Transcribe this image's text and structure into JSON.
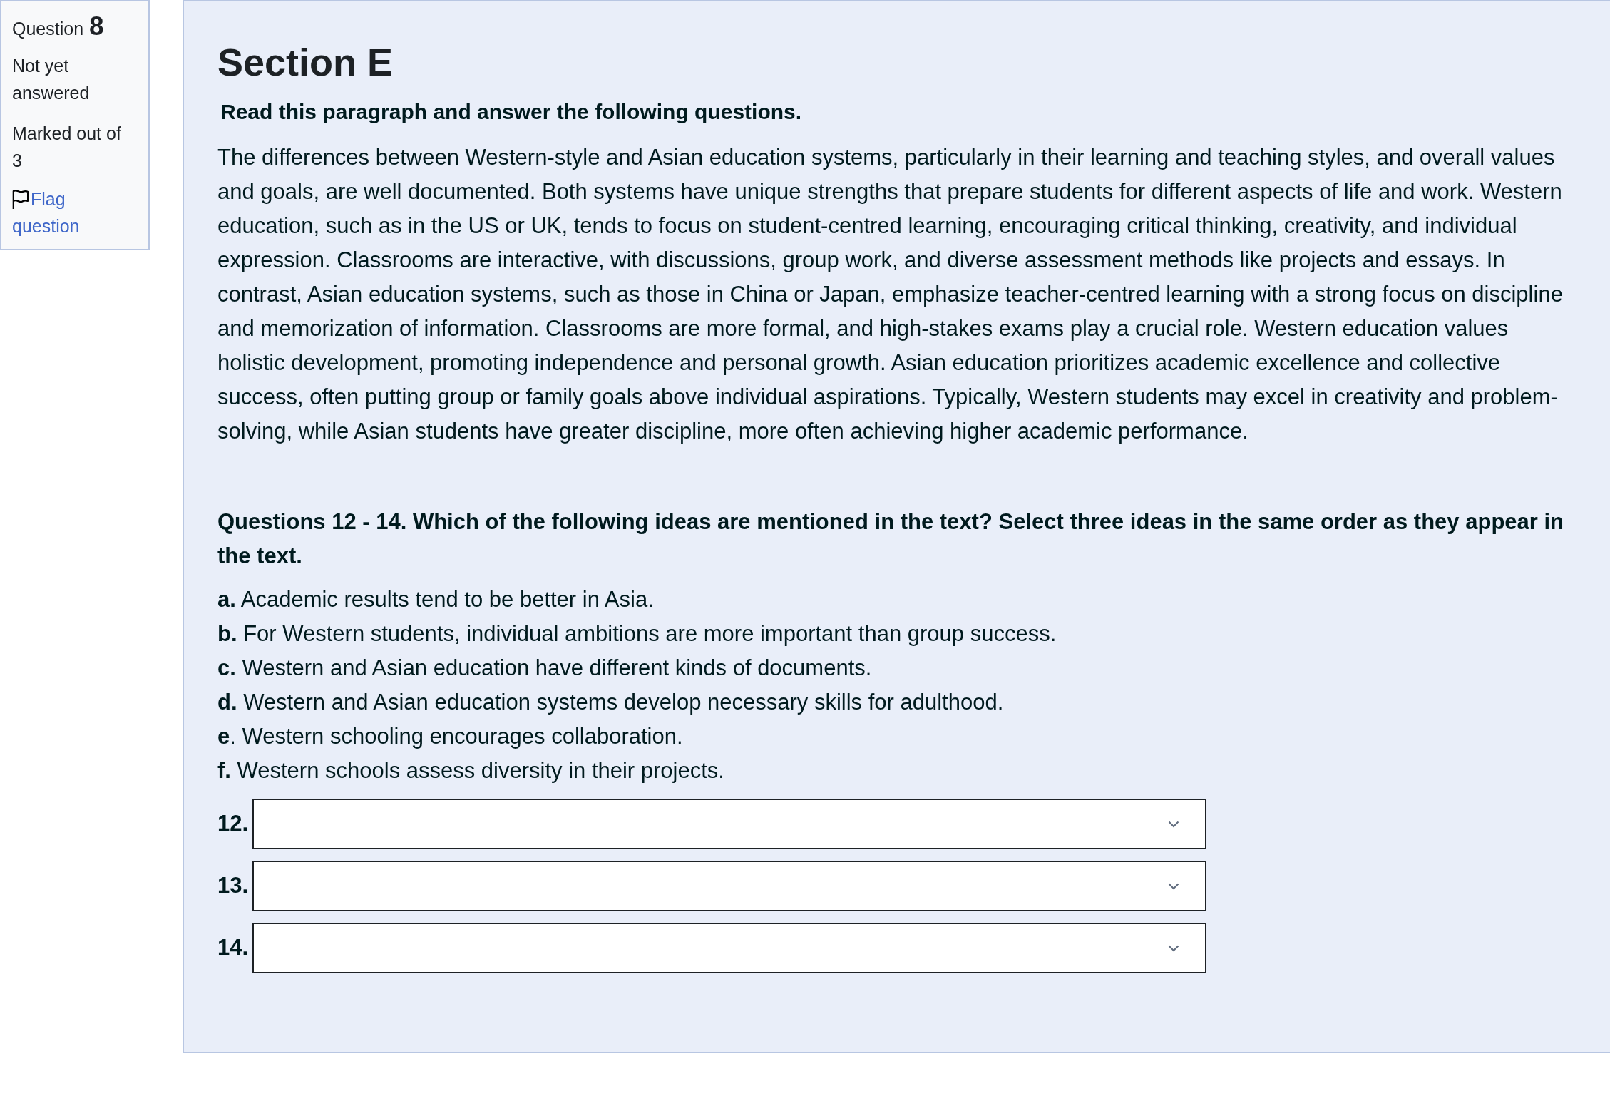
{
  "question_info": {
    "label": "Question",
    "number": "8",
    "status": "Not yet answered",
    "marks": "Marked out of 3",
    "flag": {
      "label": "Flag question",
      "flagged": false
    }
  },
  "section": {
    "title": "Section E",
    "instruction": "Read this paragraph and answer the following questions.",
    "passage": "The differences between Western-style and Asian education systems, particularly in their learning and teaching styles, and overall values and goals, are well documented. Both systems have unique strengths that prepare students for different aspects of life and work. Western education, such as in the US or UK, tends to focus on student-centred learning, encouraging critical thinking, creativity, and individual expression. Classrooms are interactive, with discussions, group work, and diverse assessment methods like projects and essays. In contrast, Asian education systems, such as those in China or Japan, emphasize teacher-centred learning with a strong focus on discipline and memorization of information. Classrooms are more formal, and high-stakes exams play a crucial role. Western education values holistic development, promoting independence and personal growth. Asian education prioritizes academic excellence and collective success, often putting group or family goals above individual aspirations. Typically, Western students may excel in creativity and problem-solving, while Asian students have greater discipline, more often achieving higher academic performance."
  },
  "question": {
    "prompt": "Questions 12 - 14. Which of the following ideas are mentioned in the text? Select three ideas in the same order as they appear in the text.",
    "options": [
      "**a.** Academic results tend to be better in Asia.",
      "**b.** For Western students, individual ambitions are more important than group success.",
      "**c.** Western and Asian education have different kinds of documents.",
      "**d.** Western and Asian education systems develop necessary skills for adulthood.",
      "**e**. Western schooling encourages collaboration.",
      "**f.** Western schools assess diversity in their projects."
    ],
    "answers": [
      {
        "label": "12."
      },
      {
        "label": "13."
      },
      {
        "label": "14."
      }
    ]
  }
}
